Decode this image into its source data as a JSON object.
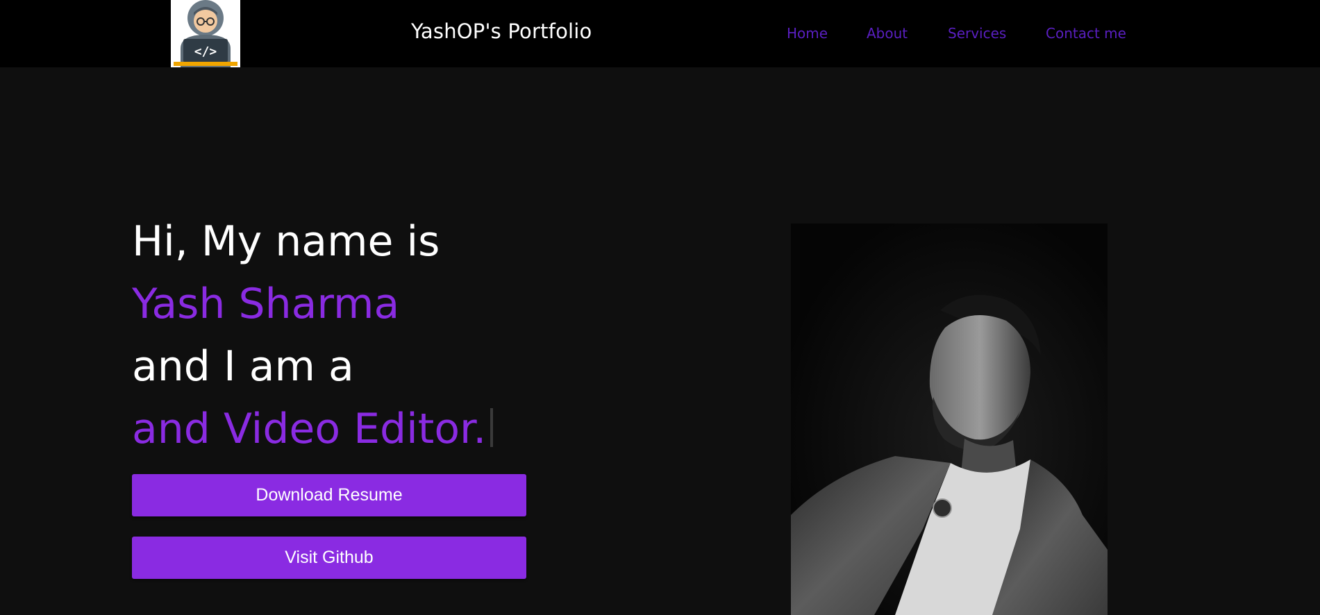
{
  "header": {
    "logo_icon": "developer-avatar-icon",
    "brand": "YashOP's Portfolio",
    "nav": [
      {
        "label": "Home"
      },
      {
        "label": "About"
      },
      {
        "label": "Services"
      },
      {
        "label": "Contact me"
      }
    ],
    "nav_color": "#5a1fc2"
  },
  "hero": {
    "greeting": "Hi, My name is",
    "name": "Yash Sharma",
    "intro": "and I am a",
    "typed_role": "and Video Editor.",
    "accent_color": "#8a2be2",
    "buttons": {
      "resume": "Download Resume",
      "github": "Visit Github"
    },
    "photo": "portrait-photo"
  }
}
